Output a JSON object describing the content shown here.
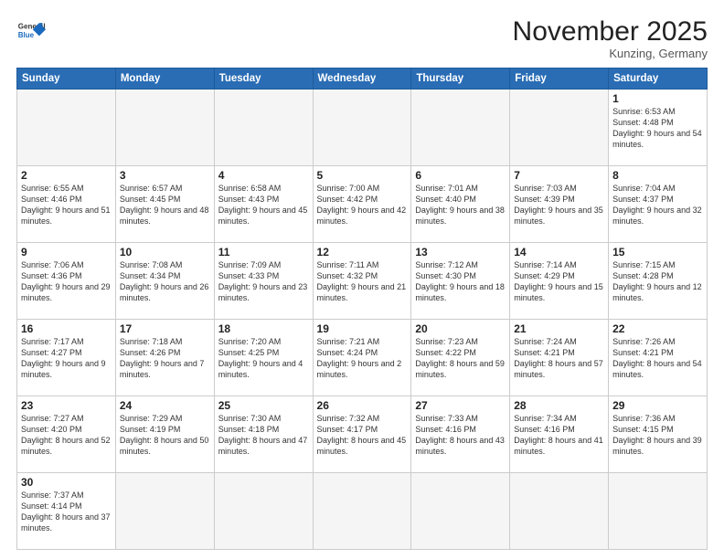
{
  "header": {
    "logo_general": "General",
    "logo_blue": "Blue",
    "month_title": "November 2025",
    "location": "Kunzing, Germany"
  },
  "weekdays": [
    "Sunday",
    "Monday",
    "Tuesday",
    "Wednesday",
    "Thursday",
    "Friday",
    "Saturday"
  ],
  "weeks": [
    [
      {
        "day": "",
        "empty": true
      },
      {
        "day": "",
        "empty": true
      },
      {
        "day": "",
        "empty": true
      },
      {
        "day": "",
        "empty": true
      },
      {
        "day": "",
        "empty": true
      },
      {
        "day": "",
        "empty": true
      },
      {
        "day": "1",
        "sunrise": "6:53 AM",
        "sunset": "4:48 PM",
        "daylight": "9 hours and 54 minutes."
      }
    ],
    [
      {
        "day": "2",
        "sunrise": "6:55 AM",
        "sunset": "4:46 PM",
        "daylight": "9 hours and 51 minutes."
      },
      {
        "day": "3",
        "sunrise": "6:57 AM",
        "sunset": "4:45 PM",
        "daylight": "9 hours and 48 minutes."
      },
      {
        "day": "4",
        "sunrise": "6:58 AM",
        "sunset": "4:43 PM",
        "daylight": "9 hours and 45 minutes."
      },
      {
        "day": "5",
        "sunrise": "7:00 AM",
        "sunset": "4:42 PM",
        "daylight": "9 hours and 42 minutes."
      },
      {
        "day": "6",
        "sunrise": "7:01 AM",
        "sunset": "4:40 PM",
        "daylight": "9 hours and 38 minutes."
      },
      {
        "day": "7",
        "sunrise": "7:03 AM",
        "sunset": "4:39 PM",
        "daylight": "9 hours and 35 minutes."
      },
      {
        "day": "8",
        "sunrise": "7:04 AM",
        "sunset": "4:37 PM",
        "daylight": "9 hours and 32 minutes."
      }
    ],
    [
      {
        "day": "9",
        "sunrise": "7:06 AM",
        "sunset": "4:36 PM",
        "daylight": "9 hours and 29 minutes."
      },
      {
        "day": "10",
        "sunrise": "7:08 AM",
        "sunset": "4:34 PM",
        "daylight": "9 hours and 26 minutes."
      },
      {
        "day": "11",
        "sunrise": "7:09 AM",
        "sunset": "4:33 PM",
        "daylight": "9 hours and 23 minutes."
      },
      {
        "day": "12",
        "sunrise": "7:11 AM",
        "sunset": "4:32 PM",
        "daylight": "9 hours and 21 minutes."
      },
      {
        "day": "13",
        "sunrise": "7:12 AM",
        "sunset": "4:30 PM",
        "daylight": "9 hours and 18 minutes."
      },
      {
        "day": "14",
        "sunrise": "7:14 AM",
        "sunset": "4:29 PM",
        "daylight": "9 hours and 15 minutes."
      },
      {
        "day": "15",
        "sunrise": "7:15 AM",
        "sunset": "4:28 PM",
        "daylight": "9 hours and 12 minutes."
      }
    ],
    [
      {
        "day": "16",
        "sunrise": "7:17 AM",
        "sunset": "4:27 PM",
        "daylight": "9 hours and 9 minutes."
      },
      {
        "day": "17",
        "sunrise": "7:18 AM",
        "sunset": "4:26 PM",
        "daylight": "9 hours and 7 minutes."
      },
      {
        "day": "18",
        "sunrise": "7:20 AM",
        "sunset": "4:25 PM",
        "daylight": "9 hours and 4 minutes."
      },
      {
        "day": "19",
        "sunrise": "7:21 AM",
        "sunset": "4:24 PM",
        "daylight": "9 hours and 2 minutes."
      },
      {
        "day": "20",
        "sunrise": "7:23 AM",
        "sunset": "4:22 PM",
        "daylight": "8 hours and 59 minutes."
      },
      {
        "day": "21",
        "sunrise": "7:24 AM",
        "sunset": "4:21 PM",
        "daylight": "8 hours and 57 minutes."
      },
      {
        "day": "22",
        "sunrise": "7:26 AM",
        "sunset": "4:21 PM",
        "daylight": "8 hours and 54 minutes."
      }
    ],
    [
      {
        "day": "23",
        "sunrise": "7:27 AM",
        "sunset": "4:20 PM",
        "daylight": "8 hours and 52 minutes."
      },
      {
        "day": "24",
        "sunrise": "7:29 AM",
        "sunset": "4:19 PM",
        "daylight": "8 hours and 50 minutes."
      },
      {
        "day": "25",
        "sunrise": "7:30 AM",
        "sunset": "4:18 PM",
        "daylight": "8 hours and 47 minutes."
      },
      {
        "day": "26",
        "sunrise": "7:32 AM",
        "sunset": "4:17 PM",
        "daylight": "8 hours and 45 minutes."
      },
      {
        "day": "27",
        "sunrise": "7:33 AM",
        "sunset": "4:16 PM",
        "daylight": "8 hours and 43 minutes."
      },
      {
        "day": "28",
        "sunrise": "7:34 AM",
        "sunset": "4:16 PM",
        "daylight": "8 hours and 41 minutes."
      },
      {
        "day": "29",
        "sunrise": "7:36 AM",
        "sunset": "4:15 PM",
        "daylight": "8 hours and 39 minutes."
      }
    ],
    [
      {
        "day": "30",
        "sunrise": "7:37 AM",
        "sunset": "4:14 PM",
        "daylight": "8 hours and 37 minutes."
      },
      {
        "day": "",
        "empty": true
      },
      {
        "day": "",
        "empty": true
      },
      {
        "day": "",
        "empty": true
      },
      {
        "day": "",
        "empty": true
      },
      {
        "day": "",
        "empty": true
      },
      {
        "day": "",
        "empty": true
      }
    ]
  ],
  "labels": {
    "sunrise_prefix": "Sunrise: ",
    "sunset_prefix": "Sunset: ",
    "daylight_prefix": "Daylight: "
  }
}
